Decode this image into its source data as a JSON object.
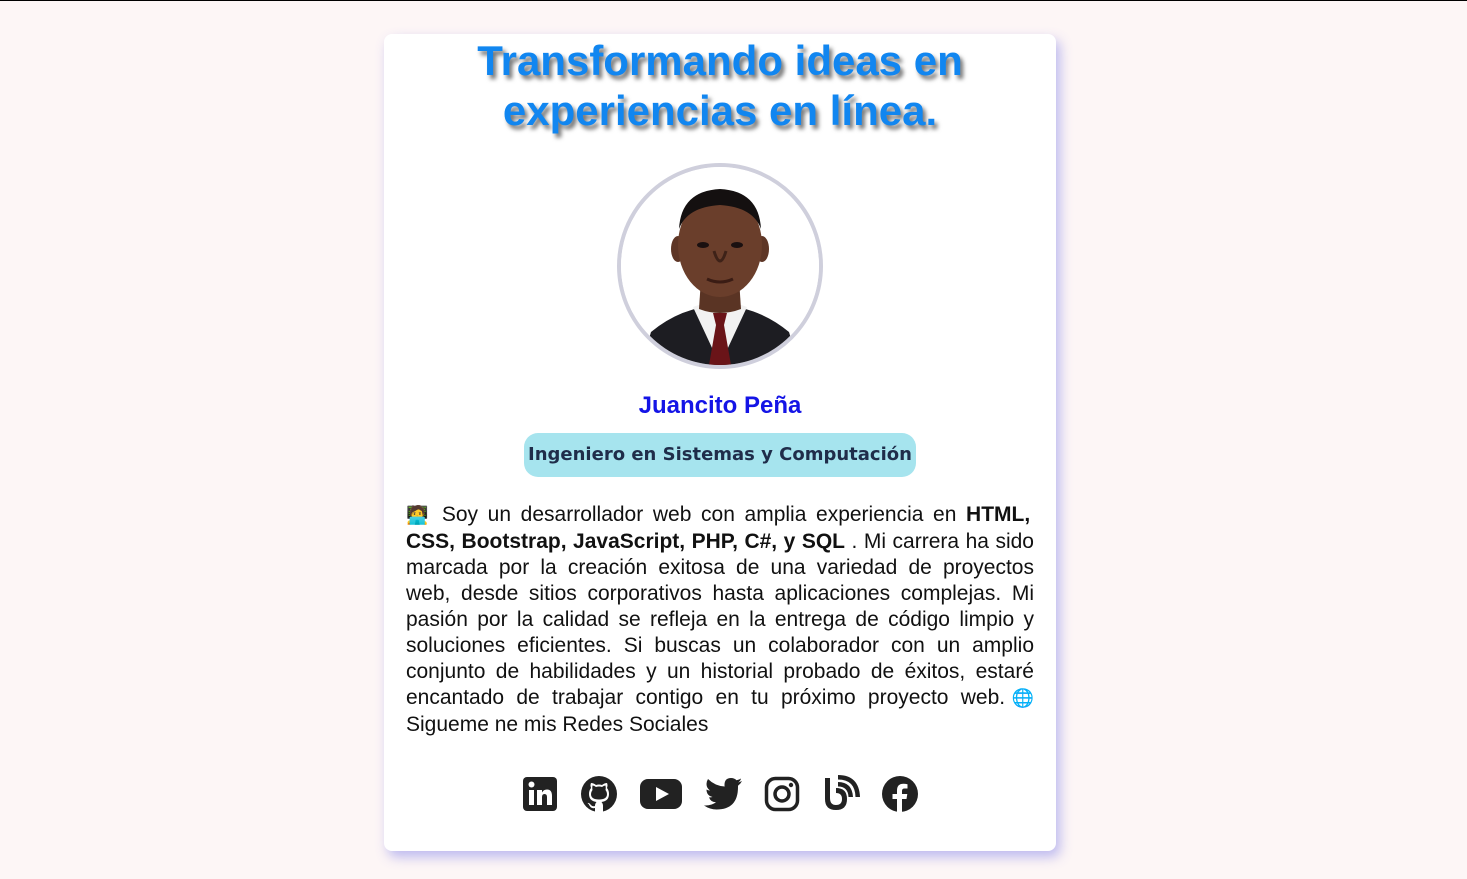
{
  "hero": {
    "line1": "Transformando ideas en",
    "line2": "experiencias en línea."
  },
  "profile": {
    "name": "Juancito Peña",
    "title": "Ingeniero en Sistemas y Computación",
    "photo": "profile-photo"
  },
  "bio": {
    "emoji_start": "🧑‍💻",
    "intro": " Soy un desarrollador web con amplia experiencia en ",
    "skills": "HTML, CSS, Bootstrap, JavaScript, PHP, C#, y SQL",
    "body": " . Mi carrera ha sido marcada por la creación exitosa de una variedad de proyectos web, desde sitios corporativos hasta aplicaciones complejas. Mi pasión por la calidad se refleja en la entrega de código limpio y soluciones eficientes. Si buscas un colaborador con un amplio conjunto de habilidades y un historial probado de éxitos, estaré encantado de trabajar contigo en tu próximo proyecto web.",
    "emoji_globe": "🌐",
    "follow": " Sigueme ne mis Redes Sociales"
  },
  "socials": [
    {
      "icon": "linkedin-icon"
    },
    {
      "icon": "github-icon"
    },
    {
      "icon": "youtube-icon"
    },
    {
      "icon": "twitter-icon"
    },
    {
      "icon": "instagram-icon"
    },
    {
      "icon": "blog-icon"
    },
    {
      "icon": "facebook-icon"
    }
  ],
  "colors": {
    "headline": "#1186f0",
    "name": "#1414e6",
    "badge_bg": "#a6e4ee",
    "page_bg": "#fdf6f6"
  }
}
